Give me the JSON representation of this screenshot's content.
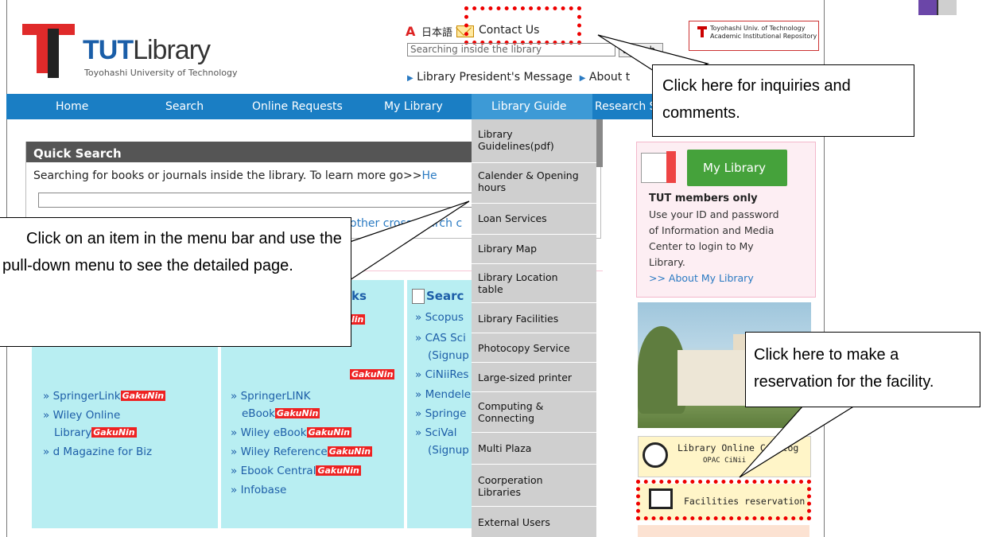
{
  "site": {
    "logo_name_a": "TUT",
    "logo_name_b": "Library",
    "logo_sub": "Toyohashi University of Technology",
    "lang_a": "A",
    "lang_label": "日本語",
    "contact_label": "Contact Us",
    "search_placeholder": "Searching inside the library",
    "search_button": "Search",
    "top_link_1": "Library President's Message",
    "top_link_2": "About t",
    "repo_line1": "Toyohashi Univ. of Technology",
    "repo_line2": "Academic Institutional Repository"
  },
  "nav": {
    "items": [
      "Home",
      "Search",
      "Online Requests",
      "My Library",
      "Library Guide",
      "Research S"
    ]
  },
  "quick_search": {
    "title": "Quick Search",
    "desc": "Searching for books or journals inside the library. To learn more go>>",
    "desc_link": "He",
    "links": "other cross search c"
  },
  "columns": {
    "col1_items": [
      "SpringerLink",
      "Wiley Online",
      "Library",
      "d Magazine for Biz"
    ],
    "col2_heading": "ks",
    "col2_items": [
      "SpringerLINK",
      "eBook",
      "Wiley eBook",
      "Wiley Reference",
      "Ebook Central",
      "Infobase"
    ],
    "col2_partial": "lin",
    "col3_heading": "Searc",
    "col3_items": [
      "Scopus",
      "CAS Sci",
      "(Signup",
      "CiNiiRes",
      "Mendele",
      "Springe",
      "SciVal",
      "(Signup"
    ],
    "gakunin": "GakuNin"
  },
  "dropdown": {
    "items": [
      "Library Guidelines(pdf)",
      "Calender & Opening hours",
      "Loan Services",
      "Library Map",
      "Library Location table",
      "Library Facilities",
      "Photocopy Service",
      "Large-sized printer",
      "Computing & Connecting",
      "Multi Plaza",
      "Coorperation Libraries",
      "External Users"
    ]
  },
  "sidebar": {
    "my_library_button": "My Library",
    "members_only": "TUT members only",
    "desc_lines": [
      "Use your ID and password",
      "of Information and Media",
      "Center to login to My",
      "Library."
    ],
    "about_link": ">> About My Library",
    "opac_title": "Library Online Catalog",
    "opac_sub": "OPAC CiNii",
    "facilities": "Facilities reservation"
  },
  "callouts": {
    "contact": "Click here for inquiries and comments.",
    "menu": "Click on an item in the menu bar and use the pull-down menu to see the detailed page.",
    "facility": "Click here to make a reservation for the facility."
  },
  "colors": {
    "nav_blue": "#1a7ec4",
    "highlight_red": "#e00000",
    "column_bg": "#b8eef2",
    "my_library_green": "#45a23b"
  }
}
